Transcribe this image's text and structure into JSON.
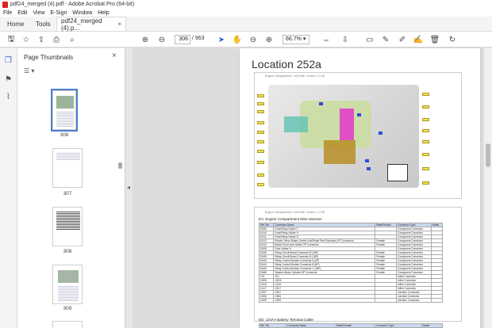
{
  "window": {
    "title": "pdf24_merged (4).pdf - Adobe Acrobat Pro (64-bit)"
  },
  "menu": [
    "File",
    "Edit",
    "View",
    "E-Sign",
    "Window",
    "Help"
  ],
  "tabs": {
    "home": "Home",
    "tools": "Tools",
    "doc": "pdf24_merged (4).p...",
    "close": "×"
  },
  "toolbar": {
    "page_current": "306",
    "page_total": "/   963",
    "zoom": "66.7%",
    "zoom_caret": "▾"
  },
  "panel": {
    "title": "Page Thumbnails",
    "close": "×",
    "options": "☰ ▾"
  },
  "thumbnails": [
    {
      "label": "306",
      "selected": true
    },
    {
      "label": "307",
      "selected": false
    },
    {
      "label": "308",
      "selected": false
    },
    {
      "label": "309",
      "selected": false
    },
    {
      "label": "",
      "selected": false
    }
  ],
  "document": {
    "title": "Location 252a",
    "header1": "Engine Compartment / Left Side / Grade 1 / LHD",
    "header2": "Engine Compartment / Left Side / Grade 1 / LHD",
    "section1": "EA: Engine Compartment Wire Harness",
    "section2": "ED: 12VAA Battery Terminal Cable",
    "table_headers": [
      "Ref. No.",
      "Connector Name",
      "Male/Female",
      "Connector Type",
      "Notes"
    ],
    "rows": [
      [
        "EA06",
        "Fuse/Relay Holder F",
        "",
        "Component Connector",
        ""
      ],
      [
        "EA10",
        "Fuse/Relay Holder H",
        "",
        "Component Connector",
        ""
      ],
      [
        "EA11",
        "Fuse/Relay Holder G",
        "",
        "Component Connector",
        ""
      ],
      [
        "EA12",
        "Electric Servo Brake Control Unit/Pedal Feel Simulator (2P Connector)",
        "Female",
        "Component Connector",
        ""
      ],
      [
        "EA13",
        "Brake Fluid Level Switch 2P Connector",
        "Female",
        "Component Connector",
        ""
      ],
      [
        "EA28",
        "Fuse Holder H",
        "",
        "Component Connector",
        ""
      ],
      [
        "EA35",
        "Relay Circuit Board Connector B (18P)",
        "Female",
        "Component Connector",
        ""
      ],
      [
        "EA36",
        "Relay Circuit Board Connector B (18P)",
        "Female",
        "Component Connector",
        ""
      ],
      [
        "EA43",
        "Relay Control Module Connector A (4P)",
        "Female",
        "Component Connector",
        ""
      ],
      [
        "EA44",
        "Relay Control Module Connector B (8P)",
        "Female",
        "Component Connector",
        ""
      ],
      [
        "EA45",
        "Relay Control Module Connector C (18P)",
        "Female",
        "Component Connector",
        ""
      ],
      [
        "EA86",
        "Tandem Motor Cylinder 8P Connector",
        "Female",
        "Component Connector",
        ""
      ],
      [
        "T01",
        "T01",
        "",
        "Inline Connector",
        ""
      ],
      [
        "C4D3",
        "C4D3",
        "",
        "Inline Connector",
        ""
      ],
      [
        "C415",
        "C415",
        "",
        "Inline Connector",
        ""
      ],
      [
        "C417",
        "C417",
        "",
        "Inline Connector",
        ""
      ],
      [
        "C507",
        "C507",
        "",
        "Junction Connector",
        ""
      ],
      [
        "C508",
        "C508",
        "",
        "Junction Connector",
        ""
      ],
      [
        "C509",
        "C509",
        "",
        "Junction Connector",
        ""
      ]
    ],
    "table2_headers": [
      "Ref. No.",
      "Connector Name",
      "Male/Female",
      "Connector Type",
      "Notes"
    ]
  },
  "colors": {
    "accent": "#4a7fd1",
    "acrobat_red": "#d7261e",
    "table_header": "#c8d8ee"
  }
}
